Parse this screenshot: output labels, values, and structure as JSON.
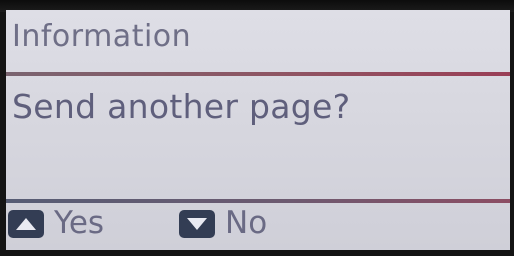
{
  "header": {
    "title": "Information"
  },
  "message": {
    "text": "Send another page?"
  },
  "softkeys": {
    "yes": {
      "icon": "triangle-up-icon",
      "label": "Yes"
    },
    "no": {
      "icon": "triangle-down-icon",
      "label": "No"
    }
  },
  "colors": {
    "screen_bg": "#d9d9e1",
    "text": "#636380",
    "key_icon_bg": "#333d54",
    "divider_accent": "#9a3f57"
  }
}
